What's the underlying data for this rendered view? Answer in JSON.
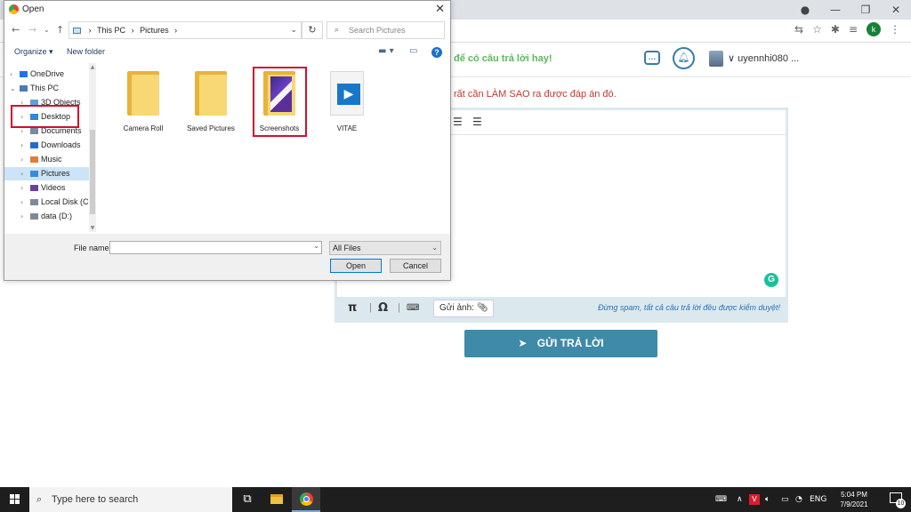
{
  "browser": {
    "window_controls": {
      "minimize": "—",
      "maximize": "❐",
      "close": "✕"
    },
    "profile_initial": "k"
  },
  "site": {
    "header_title": "để có câu trả lời hay!",
    "username": "uyennhi080 ...",
    "question_note": "rất cần LÀM SAO ra được đáp án đó.",
    "editor": {
      "attach_label": "Gửi ảnh:",
      "spam_note": "Đừng spam, tất cả câu trả lời đều được kiểm duyệt!"
    },
    "submit_label": "GỬI TRẢ LỜI"
  },
  "dialog": {
    "title": "Open",
    "breadcrumb": [
      "This PC",
      "Pictures"
    ],
    "search_placeholder": "Search Pictures",
    "organize_label": "Organize ▾",
    "new_folder_label": "New folder",
    "tree": [
      {
        "label": "OneDrive",
        "icon": "cloud-icon",
        "level": 0,
        "chev": "›"
      },
      {
        "label": "This PC",
        "icon": "pc-icon",
        "level": 0,
        "chev": "⌄"
      },
      {
        "label": "3D Objects",
        "icon": "cube-icon",
        "level": 1,
        "chev": "›"
      },
      {
        "label": "Desktop",
        "icon": "desktop-icon",
        "level": 1,
        "chev": "›"
      },
      {
        "label": "Documents",
        "icon": "documents-icon",
        "level": 1,
        "chev": "›"
      },
      {
        "label": "Downloads",
        "icon": "downloads-icon",
        "level": 1,
        "chev": "›"
      },
      {
        "label": "Music",
        "icon": "music-icon",
        "level": 1,
        "chev": "›"
      },
      {
        "label": "Pictures",
        "icon": "pictures-icon",
        "level": 1,
        "chev": "›",
        "selected": true
      },
      {
        "label": "Videos",
        "icon": "videos-icon",
        "level": 1,
        "chev": "›"
      },
      {
        "label": "Local Disk (C:)",
        "icon": "disk-icon",
        "level": 1,
        "chev": "›"
      },
      {
        "label": "data (D:)",
        "icon": "disk-icon",
        "level": 1,
        "chev": "›"
      }
    ],
    "files": [
      {
        "label": "Camera Roll",
        "type": "folder"
      },
      {
        "label": "Saved Pictures",
        "type": "folder"
      },
      {
        "label": "Screenshots",
        "type": "folder-with-image"
      },
      {
        "label": "VITAE",
        "type": "video-file"
      }
    ],
    "file_name_label": "File name:",
    "file_name_value": "",
    "file_type": "All Files",
    "open_label": "Open",
    "cancel_label": "Cancel"
  },
  "taskbar": {
    "search_placeholder": "Type here to search",
    "language": "ENG",
    "time": "5:04 PM",
    "date": "7/9/2021",
    "notification_count": "10"
  },
  "colors": {
    "highlight_red": "#d0102e",
    "submit_blue": "#3f8aa8",
    "header_green": "#5cb85c",
    "selection_blue": "#cce4f7"
  }
}
